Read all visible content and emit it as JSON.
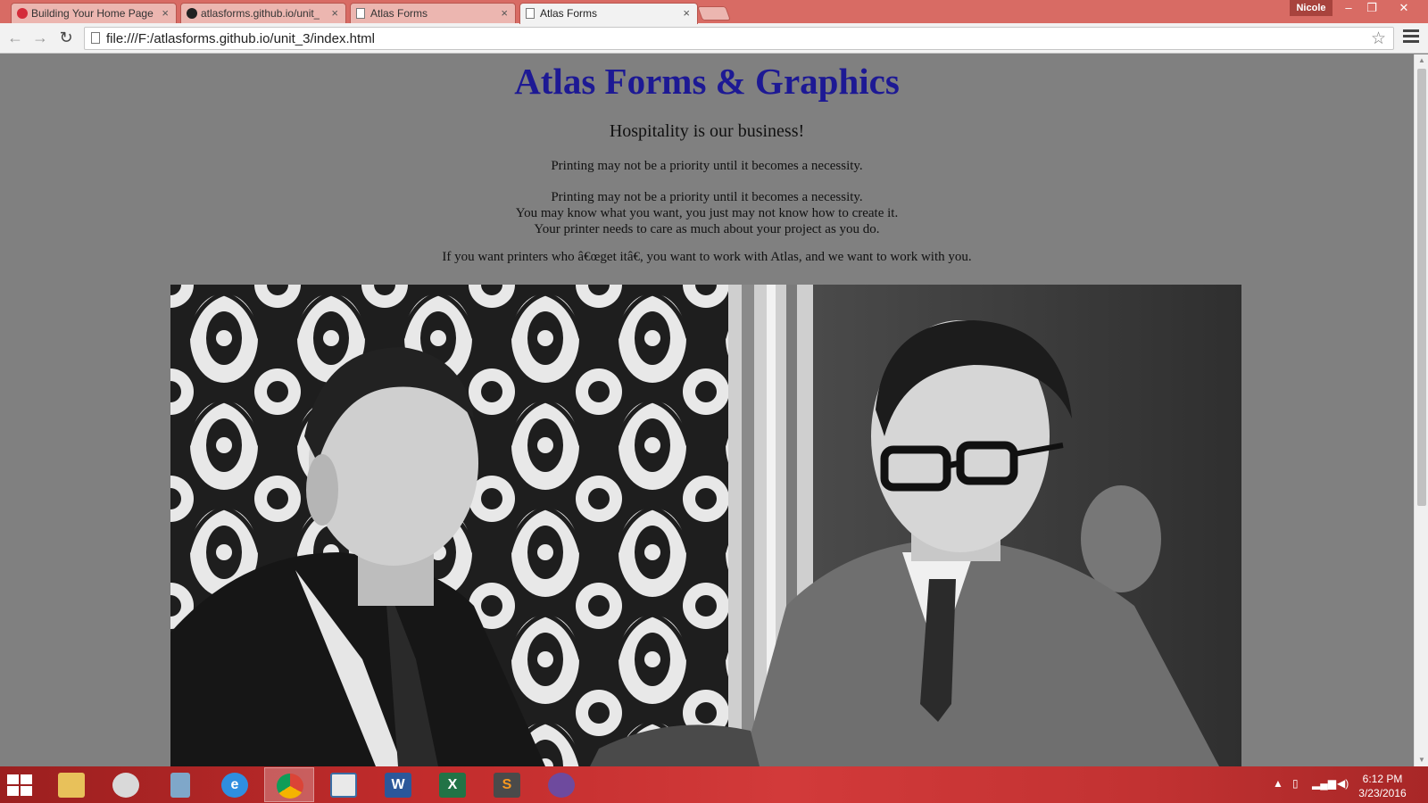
{
  "browser": {
    "tabs": [
      {
        "title": "Building Your Home Page",
        "icon": "app-icon",
        "active": false
      },
      {
        "title": "atlasforms.github.io/unit_",
        "icon": "github-icon",
        "active": false
      },
      {
        "title": "Atlas Forms",
        "icon": "page-icon",
        "active": false
      },
      {
        "title": "Atlas Forms",
        "icon": "page-icon",
        "active": true
      }
    ],
    "tab_close": "×",
    "profile_name": "Nicole",
    "window_controls": {
      "minimize": "–",
      "restore": "❐",
      "close": "✕"
    },
    "nav": {
      "back": "←",
      "forward": "→",
      "reload": "↻"
    },
    "url": "file:///F:/atlasforms.github.io/unit_3/index.html",
    "bookmark_star": "☆"
  },
  "page": {
    "title": "Atlas Forms & Graphics",
    "tagline": "Hospitality is our business!",
    "paragraph1": "Printing may not be a priority until it becomes a necessity.",
    "paragraph2_lines": [
      "Printing may not be a priority until it becomes a necessity.",
      "You may know what you want, you just may not know how to create it.",
      "Your printer needs to care as much about your project as you do."
    ],
    "paragraph3": "If you want printers who â€œget itâ€, you want to work with Atlas, and we want to work with you.",
    "photo_description_icon": "black-and-white-photo"
  },
  "taskbar": {
    "apps": [
      {
        "name": "file-explorer",
        "active": false
      },
      {
        "name": "paint",
        "active": false
      },
      {
        "name": "calculator",
        "active": false
      },
      {
        "name": "internet-explorer",
        "active": false
      },
      {
        "name": "chrome",
        "active": true
      },
      {
        "name": "notepad",
        "active": false
      },
      {
        "name": "word",
        "label": "W",
        "active": false
      },
      {
        "name": "excel",
        "label": "X",
        "active": false
      },
      {
        "name": "sublime-text",
        "label": "S",
        "active": false
      },
      {
        "name": "github-desktop",
        "active": false
      }
    ],
    "clock_time": "6:12 PM",
    "clock_date": "3/23/2016"
  },
  "colors": {
    "tab_strip": "#d86b64",
    "page_background": "#808080",
    "title_color": "#1d1994",
    "taskbar": "#c22c2c"
  }
}
